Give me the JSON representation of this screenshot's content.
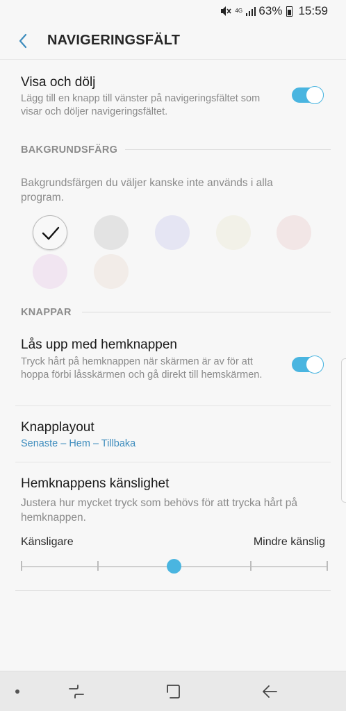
{
  "status_bar": {
    "network": "4G",
    "battery_percent": "63%",
    "time": "15:59",
    "icons": [
      "mute-icon",
      "signal-icon",
      "battery-icon"
    ]
  },
  "app_bar": {
    "title": "NAVIGERINGSFÄLT",
    "back_icon": "back-chevron-icon"
  },
  "visa_och_dolj": {
    "title": "Visa och dölj",
    "description": "Lägg till en knapp till vänster på navigeringsfältet som visar och döljer navigeringsfältet.",
    "enabled": true
  },
  "background_section": {
    "header": "BAKGRUNDSFÄRG",
    "description": "Bakgrundsfärgen du väljer kanske inte används i alla program.",
    "swatches": [
      {
        "color": "#f8f8f8",
        "selected": true
      },
      {
        "color": "#e3e3e3",
        "selected": false
      },
      {
        "color": "#e5e5f3",
        "selected": false
      },
      {
        "color": "#f2f1e8",
        "selected": false
      },
      {
        "color": "#f2e6e6",
        "selected": false
      },
      {
        "color": "#f1e5f1",
        "selected": false
      },
      {
        "color": "#f2ece8",
        "selected": false
      }
    ]
  },
  "buttons_section": {
    "header": "KNAPPAR",
    "unlock": {
      "title": "Lås upp med hemknappen",
      "description": "Tryck hårt på hemknappen när skärmen är av för att hoppa förbi låsskärmen och gå direkt till hemskärmen.",
      "enabled": true
    },
    "layout": {
      "title": "Knapplayout",
      "value": "Senaste – Hem – Tillbaka"
    },
    "sensitivity": {
      "title": "Hemknappens känslighet",
      "description": "Justera hur mycket tryck som behövs för att trycka hårt på hemknappen.",
      "min_label": "Känsligare",
      "max_label": "Mindre känslig",
      "level": 3,
      "levels": 5
    }
  },
  "colors": {
    "accent": "#4ab5e0",
    "link": "#3d8cbd"
  },
  "nav_bar": {
    "icons": [
      "recents-icon",
      "home-icon",
      "back-icon"
    ]
  }
}
